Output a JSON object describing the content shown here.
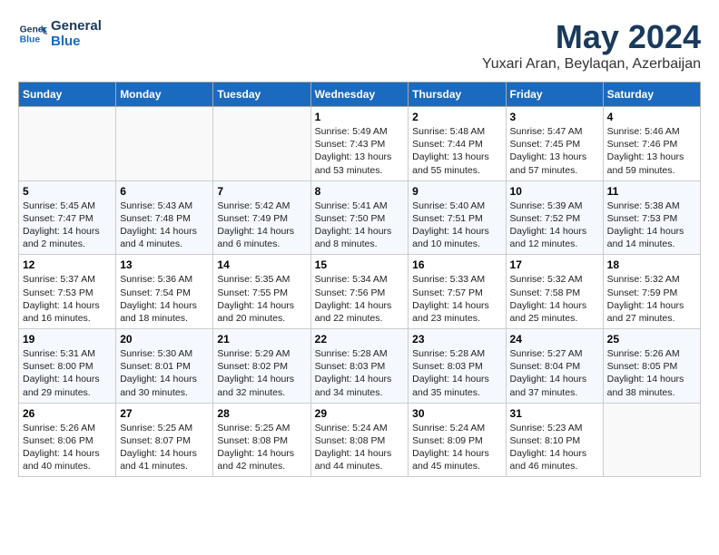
{
  "header": {
    "logo_line1": "General",
    "logo_line2": "Blue",
    "main_title": "May 2024",
    "subtitle": "Yuxari Aran, Beylaqan, Azerbaijan"
  },
  "days_of_week": [
    "Sunday",
    "Monday",
    "Tuesday",
    "Wednesday",
    "Thursday",
    "Friday",
    "Saturday"
  ],
  "weeks": [
    {
      "days": [
        {
          "num": "",
          "content": ""
        },
        {
          "num": "",
          "content": ""
        },
        {
          "num": "",
          "content": ""
        },
        {
          "num": "1",
          "content": "Sunrise: 5:49 AM\nSunset: 7:43 PM\nDaylight: 13 hours and 53 minutes."
        },
        {
          "num": "2",
          "content": "Sunrise: 5:48 AM\nSunset: 7:44 PM\nDaylight: 13 hours and 55 minutes."
        },
        {
          "num": "3",
          "content": "Sunrise: 5:47 AM\nSunset: 7:45 PM\nDaylight: 13 hours and 57 minutes."
        },
        {
          "num": "4",
          "content": "Sunrise: 5:46 AM\nSunset: 7:46 PM\nDaylight: 13 hours and 59 minutes."
        }
      ]
    },
    {
      "days": [
        {
          "num": "5",
          "content": "Sunrise: 5:45 AM\nSunset: 7:47 PM\nDaylight: 14 hours and 2 minutes."
        },
        {
          "num": "6",
          "content": "Sunrise: 5:43 AM\nSunset: 7:48 PM\nDaylight: 14 hours and 4 minutes."
        },
        {
          "num": "7",
          "content": "Sunrise: 5:42 AM\nSunset: 7:49 PM\nDaylight: 14 hours and 6 minutes."
        },
        {
          "num": "8",
          "content": "Sunrise: 5:41 AM\nSunset: 7:50 PM\nDaylight: 14 hours and 8 minutes."
        },
        {
          "num": "9",
          "content": "Sunrise: 5:40 AM\nSunset: 7:51 PM\nDaylight: 14 hours and 10 minutes."
        },
        {
          "num": "10",
          "content": "Sunrise: 5:39 AM\nSunset: 7:52 PM\nDaylight: 14 hours and 12 minutes."
        },
        {
          "num": "11",
          "content": "Sunrise: 5:38 AM\nSunset: 7:53 PM\nDaylight: 14 hours and 14 minutes."
        }
      ]
    },
    {
      "days": [
        {
          "num": "12",
          "content": "Sunrise: 5:37 AM\nSunset: 7:53 PM\nDaylight: 14 hours and 16 minutes."
        },
        {
          "num": "13",
          "content": "Sunrise: 5:36 AM\nSunset: 7:54 PM\nDaylight: 14 hours and 18 minutes."
        },
        {
          "num": "14",
          "content": "Sunrise: 5:35 AM\nSunset: 7:55 PM\nDaylight: 14 hours and 20 minutes."
        },
        {
          "num": "15",
          "content": "Sunrise: 5:34 AM\nSunset: 7:56 PM\nDaylight: 14 hours and 22 minutes."
        },
        {
          "num": "16",
          "content": "Sunrise: 5:33 AM\nSunset: 7:57 PM\nDaylight: 14 hours and 23 minutes."
        },
        {
          "num": "17",
          "content": "Sunrise: 5:32 AM\nSunset: 7:58 PM\nDaylight: 14 hours and 25 minutes."
        },
        {
          "num": "18",
          "content": "Sunrise: 5:32 AM\nSunset: 7:59 PM\nDaylight: 14 hours and 27 minutes."
        }
      ]
    },
    {
      "days": [
        {
          "num": "19",
          "content": "Sunrise: 5:31 AM\nSunset: 8:00 PM\nDaylight: 14 hours and 29 minutes."
        },
        {
          "num": "20",
          "content": "Sunrise: 5:30 AM\nSunset: 8:01 PM\nDaylight: 14 hours and 30 minutes."
        },
        {
          "num": "21",
          "content": "Sunrise: 5:29 AM\nSunset: 8:02 PM\nDaylight: 14 hours and 32 minutes."
        },
        {
          "num": "22",
          "content": "Sunrise: 5:28 AM\nSunset: 8:03 PM\nDaylight: 14 hours and 34 minutes."
        },
        {
          "num": "23",
          "content": "Sunrise: 5:28 AM\nSunset: 8:03 PM\nDaylight: 14 hours and 35 minutes."
        },
        {
          "num": "24",
          "content": "Sunrise: 5:27 AM\nSunset: 8:04 PM\nDaylight: 14 hours and 37 minutes."
        },
        {
          "num": "25",
          "content": "Sunrise: 5:26 AM\nSunset: 8:05 PM\nDaylight: 14 hours and 38 minutes."
        }
      ]
    },
    {
      "days": [
        {
          "num": "26",
          "content": "Sunrise: 5:26 AM\nSunset: 8:06 PM\nDaylight: 14 hours and 40 minutes."
        },
        {
          "num": "27",
          "content": "Sunrise: 5:25 AM\nSunset: 8:07 PM\nDaylight: 14 hours and 41 minutes."
        },
        {
          "num": "28",
          "content": "Sunrise: 5:25 AM\nSunset: 8:08 PM\nDaylight: 14 hours and 42 minutes."
        },
        {
          "num": "29",
          "content": "Sunrise: 5:24 AM\nSunset: 8:08 PM\nDaylight: 14 hours and 44 minutes."
        },
        {
          "num": "30",
          "content": "Sunrise: 5:24 AM\nSunset: 8:09 PM\nDaylight: 14 hours and 45 minutes."
        },
        {
          "num": "31",
          "content": "Sunrise: 5:23 AM\nSunset: 8:10 PM\nDaylight: 14 hours and 46 minutes."
        },
        {
          "num": "",
          "content": ""
        }
      ]
    }
  ]
}
